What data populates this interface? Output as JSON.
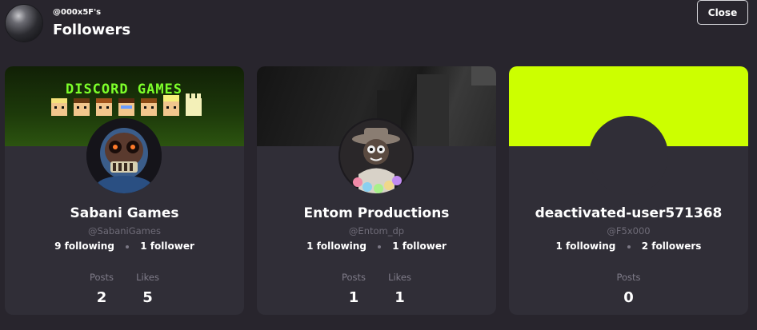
{
  "header": {
    "owner_handle": "@000x5F's",
    "title": "Followers",
    "close_label": "Close"
  },
  "cards": [
    {
      "banner_text": "DISCORD GAMES",
      "name": "Sabani Games",
      "handle": "@SabaniGames",
      "following": "9 following",
      "followers": "1 follower",
      "stats": [
        {
          "label": "Posts",
          "value": "2"
        },
        {
          "label": "Likes",
          "value": "5"
        }
      ]
    },
    {
      "name": "Entom Productions",
      "handle": "@Entom_dp",
      "following": "1 following",
      "followers": "1 follower",
      "stats": [
        {
          "label": "Posts",
          "value": "1"
        },
        {
          "label": "Likes",
          "value": "1"
        }
      ]
    },
    {
      "name": "deactivated-user571368",
      "handle": "@F5x000",
      "following": "1 following",
      "followers": "2 followers",
      "stats": [
        {
          "label": "Posts",
          "value": "0"
        }
      ]
    }
  ],
  "colors": {
    "background": "#28252d",
    "card": "#302e37",
    "banner_lime": "#ccff00",
    "muted_text": "#6f6c78"
  }
}
